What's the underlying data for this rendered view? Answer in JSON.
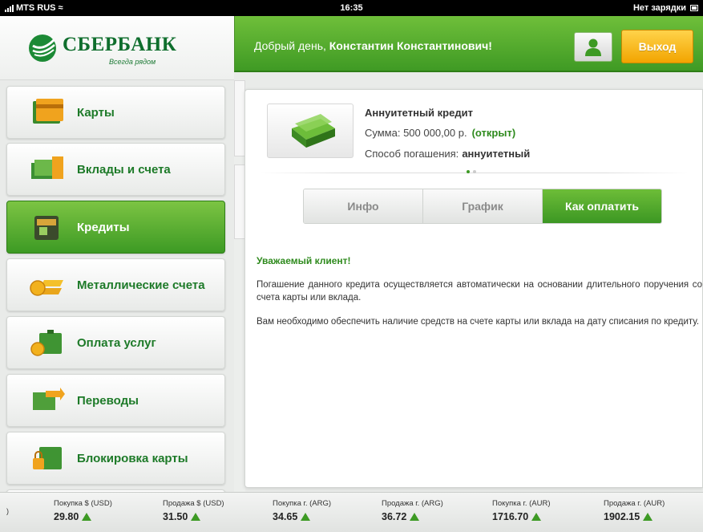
{
  "status_bar": {
    "carrier": "MTS RUS",
    "time": "16:35",
    "charging_label": "Нет зарядки"
  },
  "logo": {
    "name": "СБЕРБАНК",
    "tagline": "Всегда рядом"
  },
  "header": {
    "greeting_prefix": "Добрый день,",
    "user_name": "Константин Константинович!",
    "exit_label": "Выход"
  },
  "colors": {
    "brand_green": "#3d9a24",
    "accent_yellow": "#f2a400"
  },
  "menu": [
    {
      "label": "Карты",
      "icon": "card-icon",
      "active": false
    },
    {
      "label": "Вклады и счета",
      "icon": "banknotes-icon",
      "active": false
    },
    {
      "label": "Кредиты",
      "icon": "wallet-icon",
      "active": true
    },
    {
      "label": "Металлические счета",
      "icon": "gold-bars-icon",
      "active": false
    },
    {
      "label": "Оплата услуг",
      "icon": "coin-case-icon",
      "active": false
    },
    {
      "label": "Переводы",
      "icon": "transfer-icon",
      "active": false
    },
    {
      "label": "Блокировка карты",
      "icon": "card-lock-icon",
      "active": false
    }
  ],
  "product": {
    "title": "Аннуитетный кредит",
    "sum_label": "Сумма: 500 000,00 р.",
    "status": "(открыт)",
    "method_label": "Способ погашения:",
    "method_value": "аннуитетный",
    "image_icon": "money-stack-icon"
  },
  "tabs": [
    {
      "label": "Инфо",
      "active": false
    },
    {
      "label": "График",
      "active": false
    },
    {
      "label": "Как оплатить",
      "active": true
    }
  ],
  "message": {
    "title": "Уважаемый клиент!",
    "p1": "Погашение данного кредита осуществляется автоматически на основании длительного поручения со счета карты или вклада.",
    "p2": "Вам необходимо обеспечить наличие средств на счете карты или вклада на дату списания по кредиту."
  },
  "ticker": {
    "lead": ")",
    "items": [
      {
        "label": "Покупка $ (USD)",
        "value": "29.80"
      },
      {
        "label": "Продажа $ (USD)",
        "value": "31.50"
      },
      {
        "label": "Покупка г. (ARG)",
        "value": "34.65"
      },
      {
        "label": "Продажа г. (ARG)",
        "value": "36.72"
      },
      {
        "label": "Покупка г. (AUR)",
        "value": "1716.70"
      },
      {
        "label": "Продажа г. (AUR)",
        "value": "1902.15"
      }
    ]
  }
}
